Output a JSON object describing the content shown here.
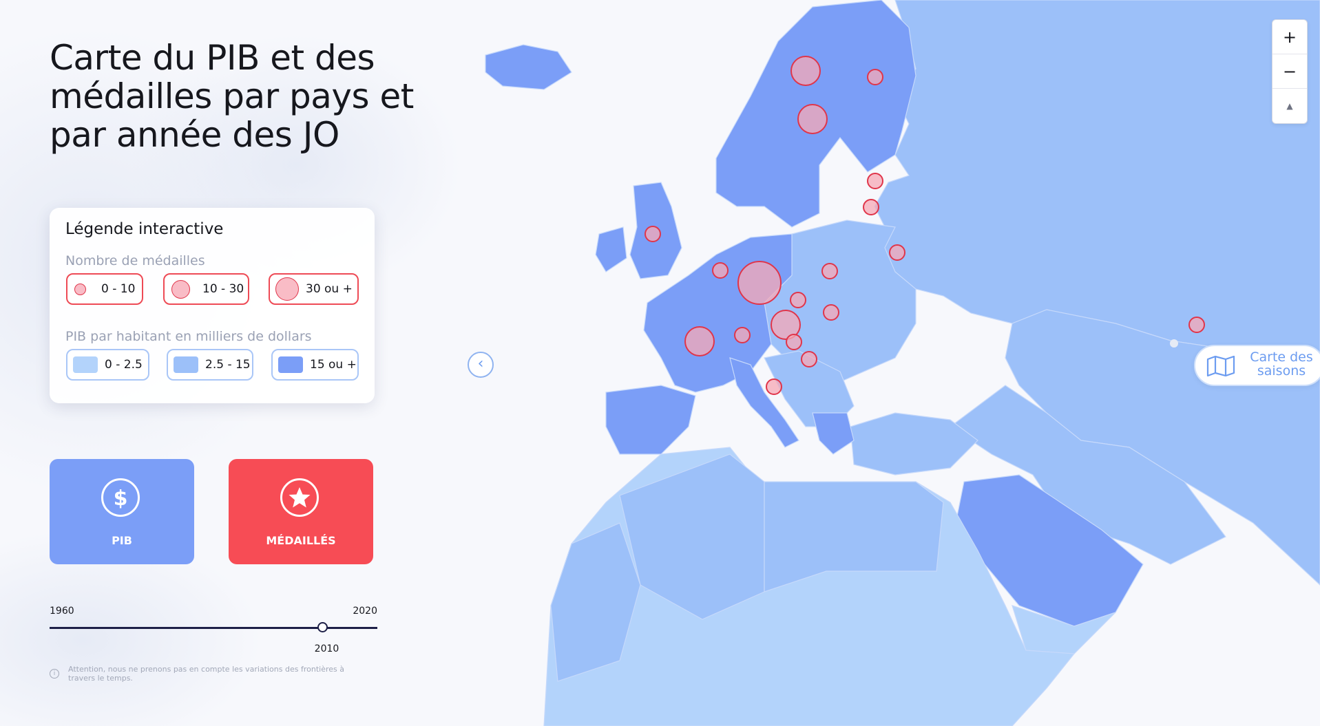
{
  "title": "Carte du PIB et des médailles par pays et par année des JO",
  "legend": {
    "title": "Légende interactive",
    "medals_label": "Nombre de médailles",
    "medal_ranges": [
      "0 - 10",
      "10 - 30",
      "30 ou +"
    ],
    "gdp_label": "PIB par habitant en milliers de dollars",
    "gdp_ranges": [
      "0 - 2.5",
      "2.5 - 15",
      "15 ou +"
    ]
  },
  "buttons": {
    "gdp": "PIB",
    "medals": "MÉDAILLÉS"
  },
  "timeline": {
    "start": "1960",
    "end": "2020",
    "current": "2010",
    "current_value": 2010
  },
  "note": "Attention, nous ne prenons pas en compte les variations des frontières à travers le temps.",
  "map_controls": {
    "zoom_in": "+",
    "zoom_out": "−",
    "reset_north": "▲"
  },
  "seasons_button": "Carte des saisons",
  "collapse_glyph": "‹",
  "colors": {
    "gdp_low": "#b3d3fb",
    "gdp_mid": "#9cc0f9",
    "gdp_high": "#7b9ef7",
    "medal_fill": "#f7a8b6",
    "medal_stroke": "#e0354a",
    "pib_button": "#7b9ef7",
    "medals_button": "#f74c55",
    "ocean": "#f7f8fc"
  },
  "icons": {
    "gdp": "dollar-icon",
    "medals": "star-icon",
    "seasons": "map-icon",
    "note": "info-icon"
  }
}
